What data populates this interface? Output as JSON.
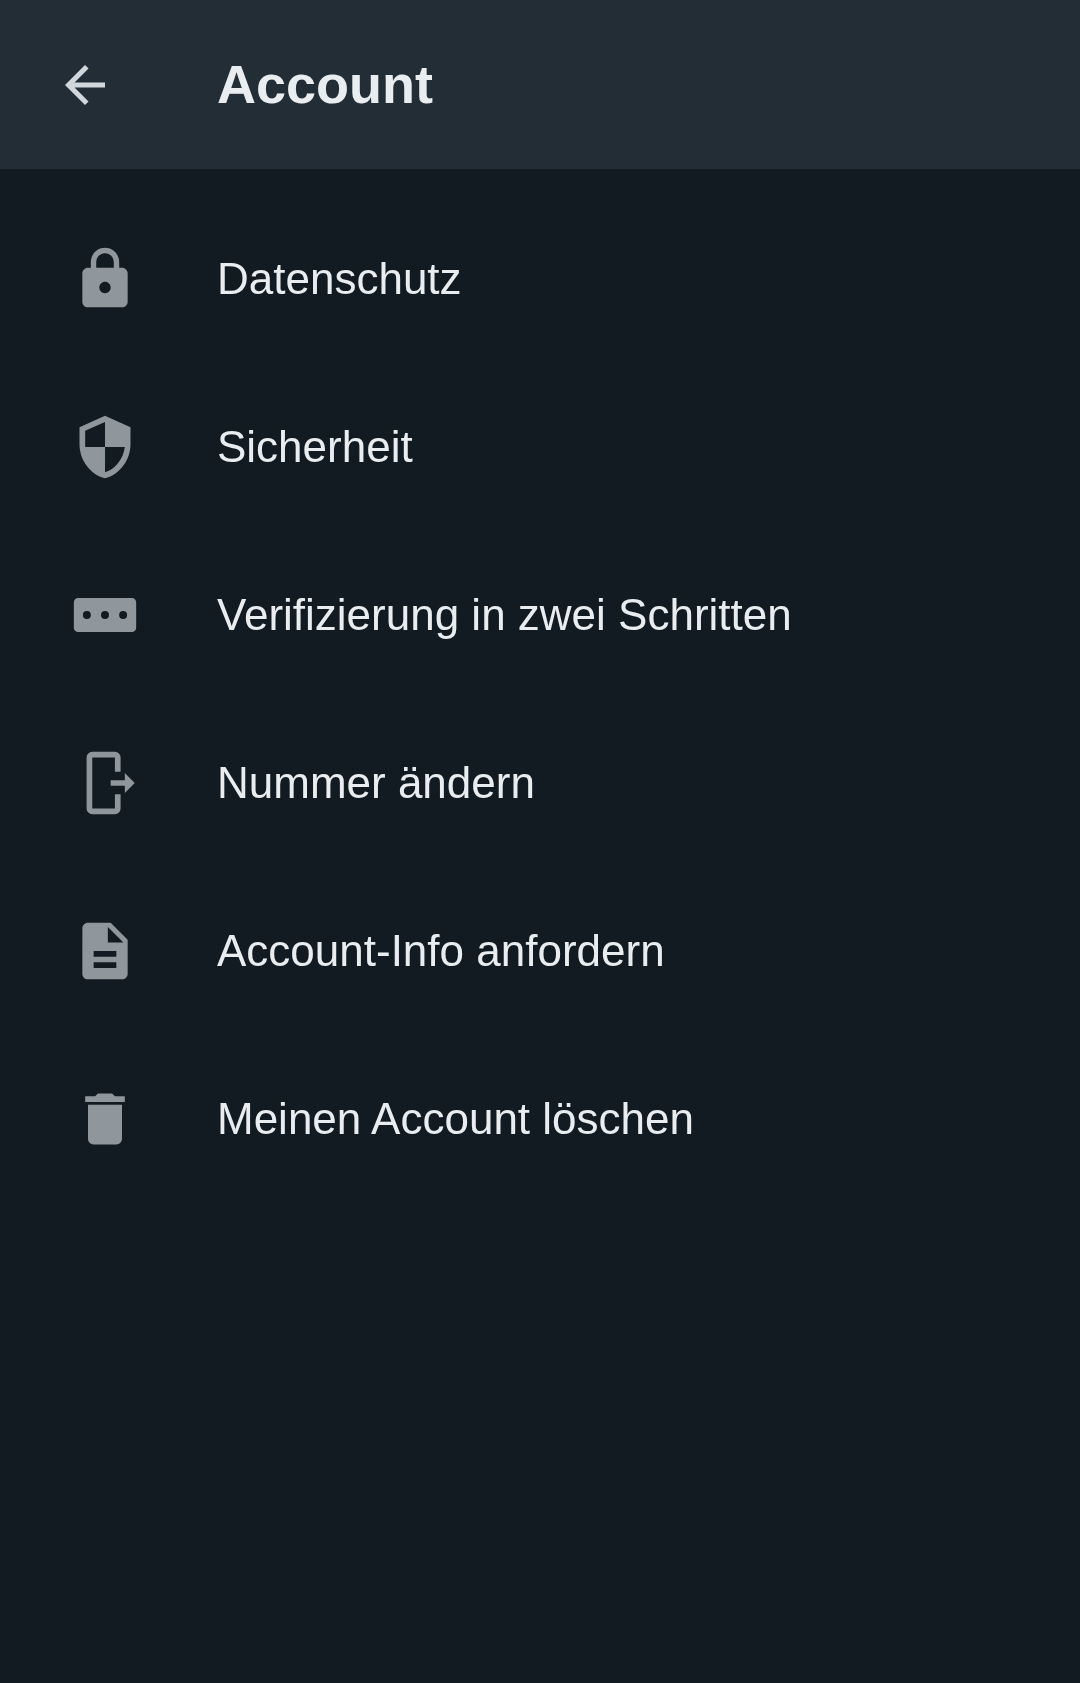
{
  "header": {
    "title": "Account"
  },
  "items": [
    {
      "label": "Datenschutz"
    },
    {
      "label": "Sicherheit"
    },
    {
      "label": "Verifizierung in zwei Schritten"
    },
    {
      "label": "Nummer ändern"
    },
    {
      "label": "Account-Info anfordern"
    },
    {
      "label": "Meinen Account löschen"
    }
  ]
}
